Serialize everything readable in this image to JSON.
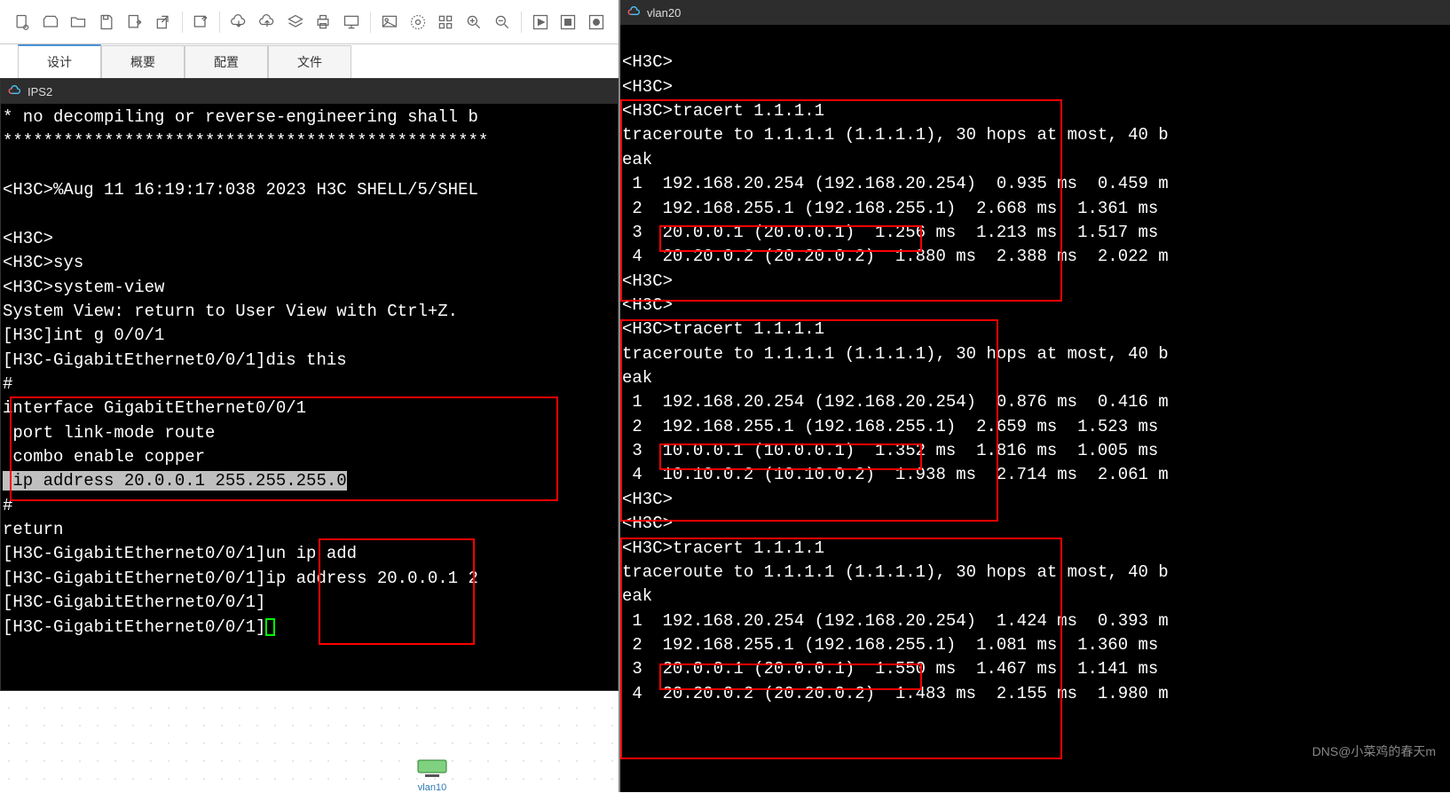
{
  "left": {
    "tabs": [
      "设计",
      "概要",
      "配置",
      "文件"
    ],
    "terminal_title": "IPS2",
    "lines": {
      "l1": "* no decompiling or reverse-engineering shall b",
      "l2": "************************************************",
      "l3": "",
      "l4": "<H3C>%Aug 11 16:19:17:038 2023 H3C SHELL/5/SHEL",
      "l5": "",
      "l6": "<H3C>",
      "l7": "<H3C>sys",
      "l8": "<H3C>system-view",
      "l9": "System View: return to User View with Ctrl+Z.",
      "l10": "[H3C]int g 0/0/1",
      "l11": "[H3C-GigabitEthernet0/0/1]dis this",
      "l12": "#",
      "l13": "interface GigabitEthernet0/0/1",
      "l14": " port link-mode route",
      "l15": " combo enable copper",
      "l16": " ip address 20.0.0.1 255.255.255.0",
      "l17": "#",
      "l18": "return",
      "l19": "[H3C-GigabitEthernet0/0/1]un ip add",
      "l20": "[H3C-GigabitEthernet0/0/1]ip address 20.0.0.1 2",
      "l21": "[H3C-GigabitEthernet0/0/1]",
      "l22": "[H3C-GigabitEthernet0/0/1]"
    },
    "device_label": "vlan10"
  },
  "right": {
    "terminal_title": "vlan20",
    "lines": {
      "r0": "",
      "r1": "<H3C>",
      "r2": "<H3C>",
      "r3": "<H3C>tracert 1.1.1.1",
      "r4": "traceroute to 1.1.1.1 (1.1.1.1), 30 hops at most, 40 b",
      "r5": "eak",
      "r6": " 1  192.168.20.254 (192.168.20.254)  0.935 ms  0.459 m",
      "r7": " 2  192.168.255.1 (192.168.255.1)  2.668 ms  1.361 ms ",
      "r8": " 3  20.0.0.1 (20.0.0.1)  1.256 ms  1.213 ms  1.517 ms",
      "r9": " 4  20.20.0.2 (20.20.0.2)  1.880 ms  2.388 ms  2.022 m",
      "r10": "<H3C>",
      "r11": "<H3C>",
      "r12": "<H3C>tracert 1.1.1.1",
      "r13": "traceroute to 1.1.1.1 (1.1.1.1), 30 hops at most, 40 b",
      "r14": "eak",
      "r15": " 1  192.168.20.254 (192.168.20.254)  0.876 ms  0.416 m",
      "r16": " 2  192.168.255.1 (192.168.255.1)  2.659 ms  1.523 ms ",
      "r17": " 3  10.0.0.1 (10.0.0.1)  1.352 ms  1.816 ms  1.005 ms",
      "r18": " 4  10.10.0.2 (10.10.0.2)  1.938 ms  2.714 ms  2.061 m",
      "r19": "<H3C>",
      "r20": "<H3C>",
      "r21": "<H3C>tracert 1.1.1.1",
      "r22": "traceroute to 1.1.1.1 (1.1.1.1), 30 hops at most, 40 b",
      "r23": "eak",
      "r24": " 1  192.168.20.254 (192.168.20.254)  1.424 ms  0.393 m",
      "r25": " 2  192.168.255.1 (192.168.255.1)  1.081 ms  1.360 ms ",
      "r26": " 3  20.0.0.1 (20.0.0.1)  1.550 ms  1.467 ms  1.141 ms",
      "r27": " 4  20.20.0.2 (20.20.0.2)  1.483 ms  2.155 ms  1.980 m"
    }
  },
  "watermark": "DNS@小菜鸡的春天m",
  "toolbar_icons": [
    "new-doc",
    "open",
    "folder",
    "save",
    "export",
    "external",
    "edit",
    "cloud-down",
    "cloud-up",
    "layers",
    "printer",
    "monitor",
    "image",
    "settings",
    "grid",
    "zoom-in",
    "zoom-out",
    "play",
    "stop",
    "record"
  ]
}
